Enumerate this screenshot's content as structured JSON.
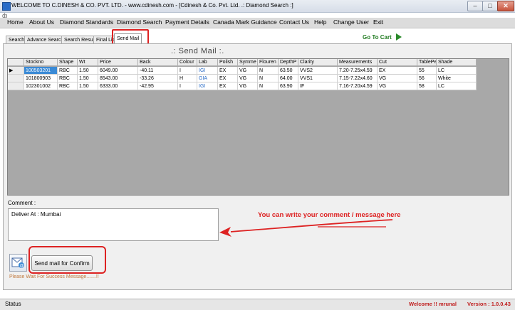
{
  "window": {
    "title": "WELCOME TO C.DINESH & CO. PVT. LTD. - www.cdinesh.com - [Cdinesh & Co. Pvt. Ltd. .: Diamond Search :]",
    "minimize": "–",
    "maximize": "□",
    "close": "✕"
  },
  "menu": [
    "Home",
    "About Us",
    "Diamond Standards",
    "Diamond Search",
    "Payment Details",
    "Canada Mark Guidance",
    "Contact Us",
    "Help",
    "Change User",
    "Exit"
  ],
  "tabs": [
    "Search",
    "Advance Search",
    "Search Result",
    "Final List",
    "Send Mail"
  ],
  "goto_cart": "Go To Cart",
  "section_title": ".: Send Mail :.",
  "table": {
    "columns": [
      "Stockno",
      "Shape",
      "Wt",
      "Price",
      "Back",
      "Colour",
      "Lab",
      "Polish",
      "Symme",
      "Flouren",
      "DepthP",
      "Clarity",
      "Measurements",
      "Cut",
      "TablePe",
      "Shade"
    ],
    "rows": [
      [
        "100503201",
        "RBC",
        "1.50",
        "6049.00",
        "-40.11",
        "I",
        "IGI",
        "EX",
        "VG",
        "N",
        "63.50",
        "VVS2",
        "7.20-7.25x4.59",
        "EX",
        "55",
        "LC"
      ],
      [
        "101800903",
        "RBC",
        "1.50",
        "8543.00",
        "-33.26",
        "H",
        "GIA",
        "EX",
        "VG",
        "N",
        "64.00",
        "VVS1",
        "7.15-7.22x4.60",
        "VG",
        "56",
        "White"
      ],
      [
        "102301002",
        "RBC",
        "1.50",
        "6333.00",
        "-42.95",
        "I",
        "IGI",
        "EX",
        "VG",
        "N",
        "63.90",
        "IF",
        "7.16-7.20x4.59",
        "VG",
        "58",
        "LC"
      ]
    ],
    "current_row_marker": "▶"
  },
  "comment": {
    "label": "Comment :",
    "value": "Deliver At : Mumbai"
  },
  "annotation": "You can write your comment / message here",
  "send_button": "Send mail for Confirm",
  "wait_message": "Please Wait For Success Message.......!!",
  "status": {
    "label": "Status",
    "welcome": "Welcome !! mrunal",
    "version": "Version : 1.0.0.43"
  },
  "colors": {
    "annotation_red": "#dd2222",
    "selected_cell": "#3a8ad6",
    "grid_background": "#a8a8a8",
    "cart_green": "#2a8a2a"
  }
}
